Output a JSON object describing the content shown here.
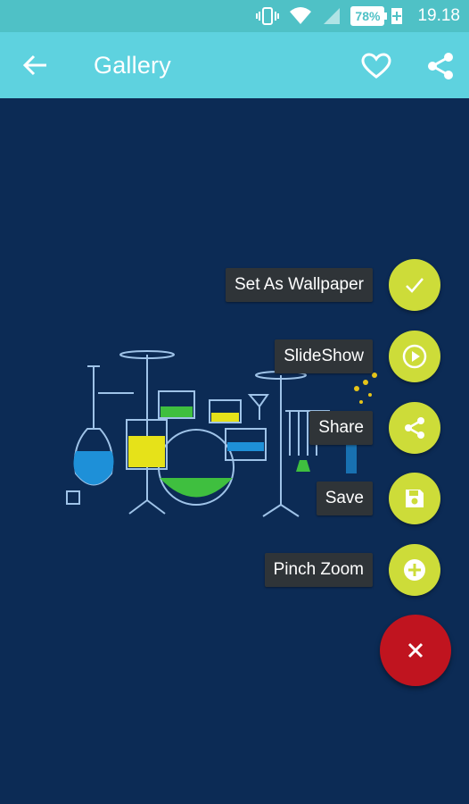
{
  "status_bar": {
    "battery_percent": "78%",
    "time": "19.18"
  },
  "app_bar": {
    "title": "Gallery"
  },
  "fab_menu": {
    "items": [
      {
        "label": "Set As Wallpaper",
        "icon": "check-icon"
      },
      {
        "label": "SlideShow",
        "icon": "play-circle-icon"
      },
      {
        "label": "Share",
        "icon": "share-icon"
      },
      {
        "label": "Save",
        "icon": "save-icon"
      },
      {
        "label": "Pinch Zoom",
        "icon": "zoom-in-icon"
      }
    ],
    "close_icon": "close-icon",
    "mini_fab_color": "#cddc39",
    "main_fab_color": "#c0141f"
  },
  "colors": {
    "status_bar": "#4fc1c6",
    "app_bar": "#5ed2df",
    "background": "#0c2b55"
  }
}
